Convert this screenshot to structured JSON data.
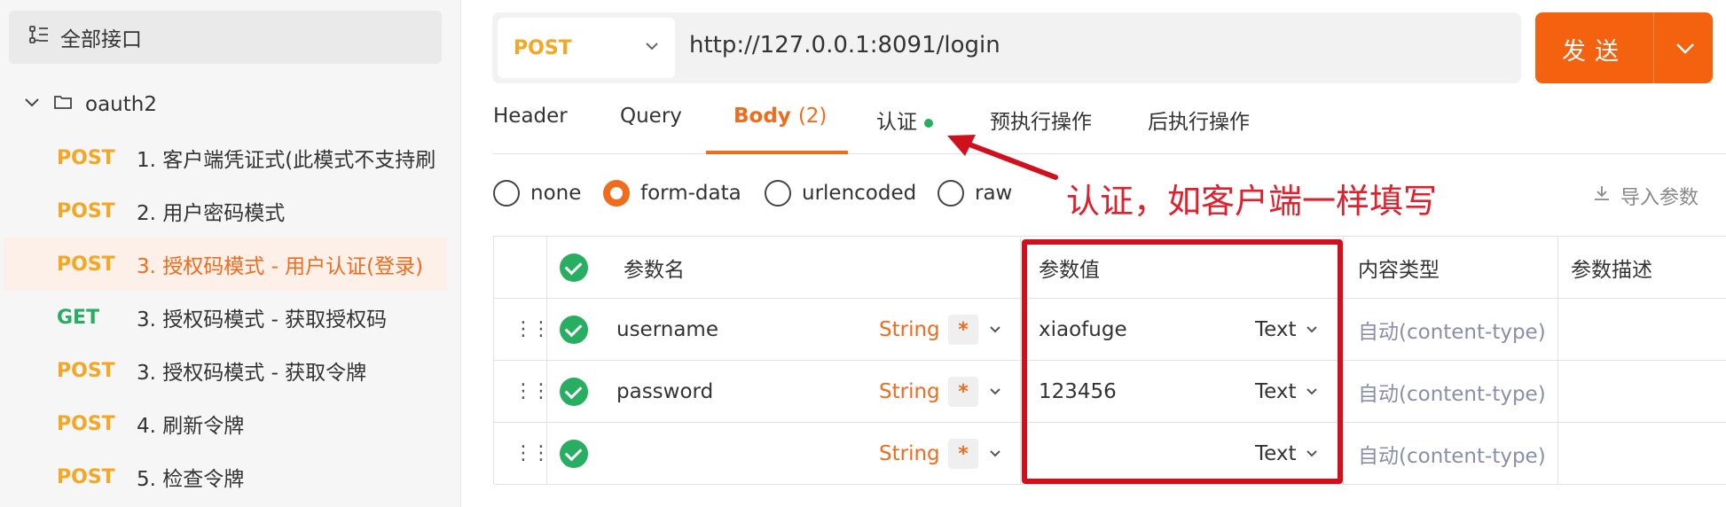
{
  "sidebar": {
    "all_apis_label": "全部接口",
    "folder_name": "oauth2",
    "items": [
      {
        "method": "POST",
        "name": "1. 客户端凭证式(此模式不支持刷"
      },
      {
        "method": "POST",
        "name": "2. 用户密码模式"
      },
      {
        "method": "POST",
        "name": "3. 授权码模式 - 用户认证(登录)"
      },
      {
        "method": "GET",
        "name": "3. 授权码模式 - 获取授权码"
      },
      {
        "method": "POST",
        "name": "3. 授权码模式 - 获取令牌"
      },
      {
        "method": "POST",
        "name": "4. 刷新令牌"
      },
      {
        "method": "POST",
        "name": "5. 检查令牌"
      }
    ]
  },
  "request": {
    "method": "POST",
    "url": "http://127.0.0.1:8091/login",
    "send_label": "发送"
  },
  "tabs": {
    "header": "Header",
    "query": "Query",
    "body": "Body",
    "body_count": "(2)",
    "auth": "认证",
    "pre": "预执行操作",
    "post": "后执行操作"
  },
  "body_types": {
    "none": "none",
    "form_data": "form-data",
    "urlencoded": "urlencoded",
    "raw": "raw",
    "selected": "form-data"
  },
  "import_label": "导入参数",
  "annotation": "认证，如客户端一样填写",
  "table": {
    "headers": {
      "name": "参数名",
      "value": "参数值",
      "content_type": "内容类型",
      "desc": "参数描述"
    },
    "rows": [
      {
        "name": "username",
        "type": "String",
        "required": "*",
        "value": "xiaofuge",
        "value_type": "Text",
        "content_type": "自动(content-type)"
      },
      {
        "name": "password",
        "type": "String",
        "required": "*",
        "value": "123456",
        "value_type": "Text",
        "content_type": "自动(content-type)"
      },
      {
        "name": "",
        "type": "String",
        "required": "*",
        "value": "",
        "value_type": "Text",
        "content_type": "自动(content-type)"
      }
    ]
  },
  "colors": {
    "accent": "#f26b1d",
    "send_button": "#f5620f",
    "post_method": "#f5a623",
    "get_method": "#27ae60",
    "annotation_red": "#d0101c"
  }
}
